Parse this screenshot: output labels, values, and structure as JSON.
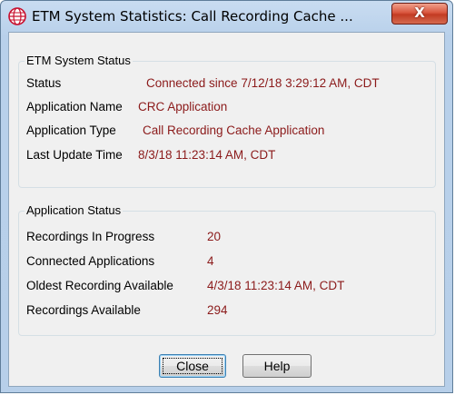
{
  "window": {
    "title": "ETM System Statistics:  Call Recording Cache ...",
    "close_glyph": "X",
    "icon": "etm-globe-icon",
    "accent_color": "#c8102e"
  },
  "etm_system_status": {
    "heading": "ETM System Status",
    "rows": [
      {
        "label": "Status",
        "value": "Connected since 7/12/18 3:29:12 AM, CDT"
      },
      {
        "label": "Application Name",
        "value": "CRC Application"
      },
      {
        "label": "Application Type",
        "value": "Call Recording Cache Application"
      },
      {
        "label": "Last Update Time",
        "value": "8/3/18 11:23:14 AM, CDT"
      }
    ]
  },
  "application_status": {
    "heading": "Application Status",
    "rows": [
      {
        "label": "Recordings In Progress",
        "value": "20"
      },
      {
        "label": "Connected Applications",
        "value": "4"
      },
      {
        "label": "Oldest Recording Available",
        "value": "4/3/18 11:23:14 AM, CDT"
      },
      {
        "label": "Recordings Available",
        "value": "294"
      }
    ]
  },
  "buttons": {
    "close_label": "Close",
    "help_label": "Help"
  },
  "colors": {
    "value_text": "#8b1a1a",
    "dialog_bg": "#f0f0f0"
  }
}
